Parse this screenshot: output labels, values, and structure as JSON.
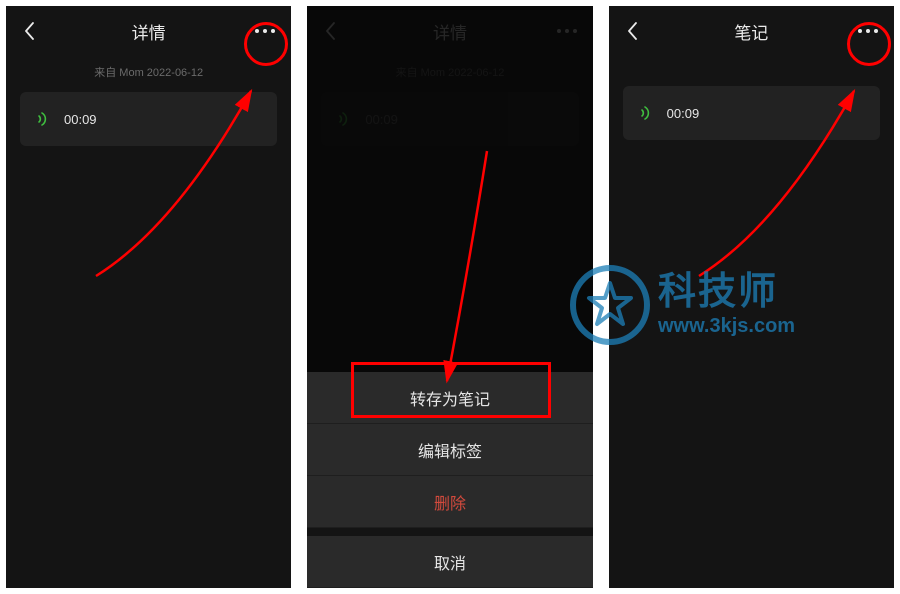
{
  "phones": {
    "p1": {
      "title": "详情",
      "meta": "来自 Mom 2022-06-12",
      "duration": "00:09"
    },
    "p2": {
      "title": "详情",
      "meta": "来自 Mom 2022-06-12",
      "duration": "00:09",
      "sheet": {
        "convert": "转存为笔记",
        "edit_tags": "编辑标签",
        "delete": "删除",
        "cancel": "取消"
      }
    },
    "p3": {
      "title": "笔记",
      "duration": "00:09"
    }
  },
  "watermark": {
    "title": "科技师",
    "url": "www.3kjs.com"
  }
}
